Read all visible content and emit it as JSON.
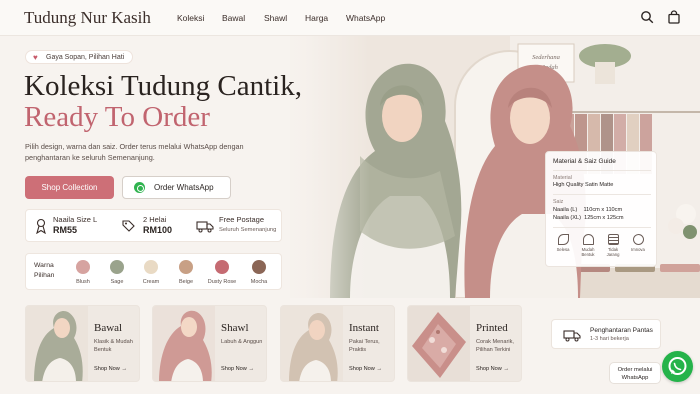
{
  "header": {
    "brand": "Tudung Nur Kasih",
    "nav": [
      "Koleksi",
      "Bawal",
      "Shawl",
      "Harga",
      "WhatsApp"
    ],
    "icons": [
      "search-icon",
      "shopping-bag-icon"
    ]
  },
  "hero": {
    "badge": "Gaya Sopan, Pilihan Hati",
    "title_line1": "Koleksi Tudung Cantik,",
    "title_line2": "Ready To Order",
    "subtitle": "Pilih design, warna dan saiz. Order terus melalui WhatsApp dengan penghantaran ke seluruh Semenanjung.",
    "cta_primary": "Shop Collection",
    "cta_whatsapp": "Order WhatsApp",
    "sign_text": "Sederhana itu Indah"
  },
  "prices": [
    {
      "icon": "ribbon-icon",
      "label": "Naaila Size L",
      "value": "RM55"
    },
    {
      "icon": "tag-icon",
      "label": "2 Helai",
      "value": "RM100"
    },
    {
      "icon": "truck-icon",
      "label": "Free Postage",
      "value": "Seluruh Semenanjung"
    }
  ],
  "colors": {
    "label": "Warna Pilihan",
    "items": [
      {
        "name": "Blush",
        "hex": "#d6a3a0"
      },
      {
        "name": "Sage",
        "hex": "#9aa38c"
      },
      {
        "name": "Cream",
        "hex": "#e9dac4"
      },
      {
        "name": "Beige",
        "hex": "#c8a085"
      },
      {
        "name": "Dusty Rose",
        "hex": "#c56b72"
      },
      {
        "name": "Mocha",
        "hex": "#8b6656"
      }
    ]
  },
  "guide": {
    "title": "Material & Saiz Guide",
    "material_label": "Material",
    "material_value": "High Quality Satin Matte",
    "size_label": "Saiz",
    "sizes": [
      "Naaila (L)    110cm x 110cm",
      "Naaila (XL)  125cm x 125cm"
    ],
    "features": [
      "Selesa",
      "Mudah Bentuk",
      "Tidak Jarang",
      "Imnova"
    ]
  },
  "products": [
    {
      "title": "Bawal",
      "desc": "Klasik & Mudah Bentuk",
      "cta": "Shop Now →"
    },
    {
      "title": "Shawl",
      "desc": "Labuh & Anggun",
      "cta": "Shop Now →"
    },
    {
      "title": "Instant",
      "desc": "Pakai Terus, Praktis",
      "cta": "Shop Now →"
    },
    {
      "title": "Printed",
      "desc": "Corak Menarik, Pilihan Terkini",
      "cta": "Shop Now →"
    }
  ],
  "delivery": {
    "title": "Penghantaran Pantas",
    "subtitle": "1-3 hari bekerja"
  },
  "chat": {
    "label": "Order melalui WhatsApp"
  }
}
